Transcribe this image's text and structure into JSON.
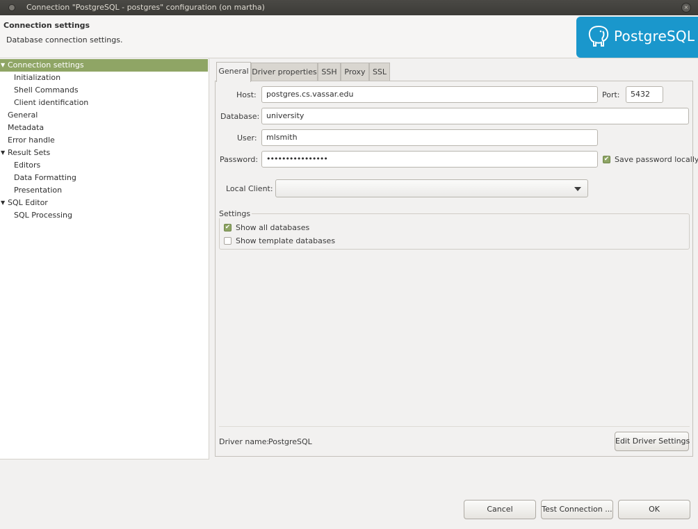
{
  "window": {
    "title": "Connection \"PostgreSQL - postgres\" configuration  (on martha)",
    "close_glyph": "×"
  },
  "header": {
    "title": "Connection settings",
    "subtitle": "Database connection settings.",
    "logo_text": "PostgreSQL",
    "logo_color": "#1a97cc"
  },
  "sidebar": {
    "selected_color": "#8fa565",
    "items": [
      {
        "label": "Connection settings",
        "arrow": "▼"
      },
      {
        "label": "Initialization"
      },
      {
        "label": "Shell Commands"
      },
      {
        "label": "Client identification"
      },
      {
        "label": "General"
      },
      {
        "label": "Metadata"
      },
      {
        "label": "Error handle"
      },
      {
        "label": "Result Sets",
        "arrow": "▼"
      },
      {
        "label": "Editors"
      },
      {
        "label": "Data Formatting"
      },
      {
        "label": "Presentation"
      },
      {
        "label": "SQL Editor",
        "arrow": "▼"
      },
      {
        "label": "SQL Processing"
      }
    ]
  },
  "tabs": [
    {
      "label": "General"
    },
    {
      "label": "Driver properties"
    },
    {
      "label": "SSH"
    },
    {
      "label": "Proxy"
    },
    {
      "label": "SSL"
    }
  ],
  "form": {
    "host_label": "Host:",
    "host_value": "postgres.cs.vassar.edu",
    "port_label": "Port:",
    "port_value": "5432",
    "database_label": "Database:",
    "database_value": "university",
    "user_label": "User:",
    "user_value": "mlsmith",
    "password_label": "Password:",
    "password_value": "••••••••••••••••",
    "save_password_label": "Save password locally",
    "save_password_checked": true,
    "local_client_label": "Local Client:",
    "local_client_value": ""
  },
  "settings": {
    "legend": "Settings",
    "show_all_label": "Show all databases",
    "show_all_checked": true,
    "show_template_label": "Show template databases",
    "show_template_checked": false
  },
  "driver": {
    "label": "Driver name:",
    "name": "PostgreSQL",
    "edit_button": "Edit Driver Settings"
  },
  "footer": {
    "cancel": "Cancel",
    "test": "Test Connection ...",
    "ok": "OK"
  },
  "check_glyph": "✔"
}
